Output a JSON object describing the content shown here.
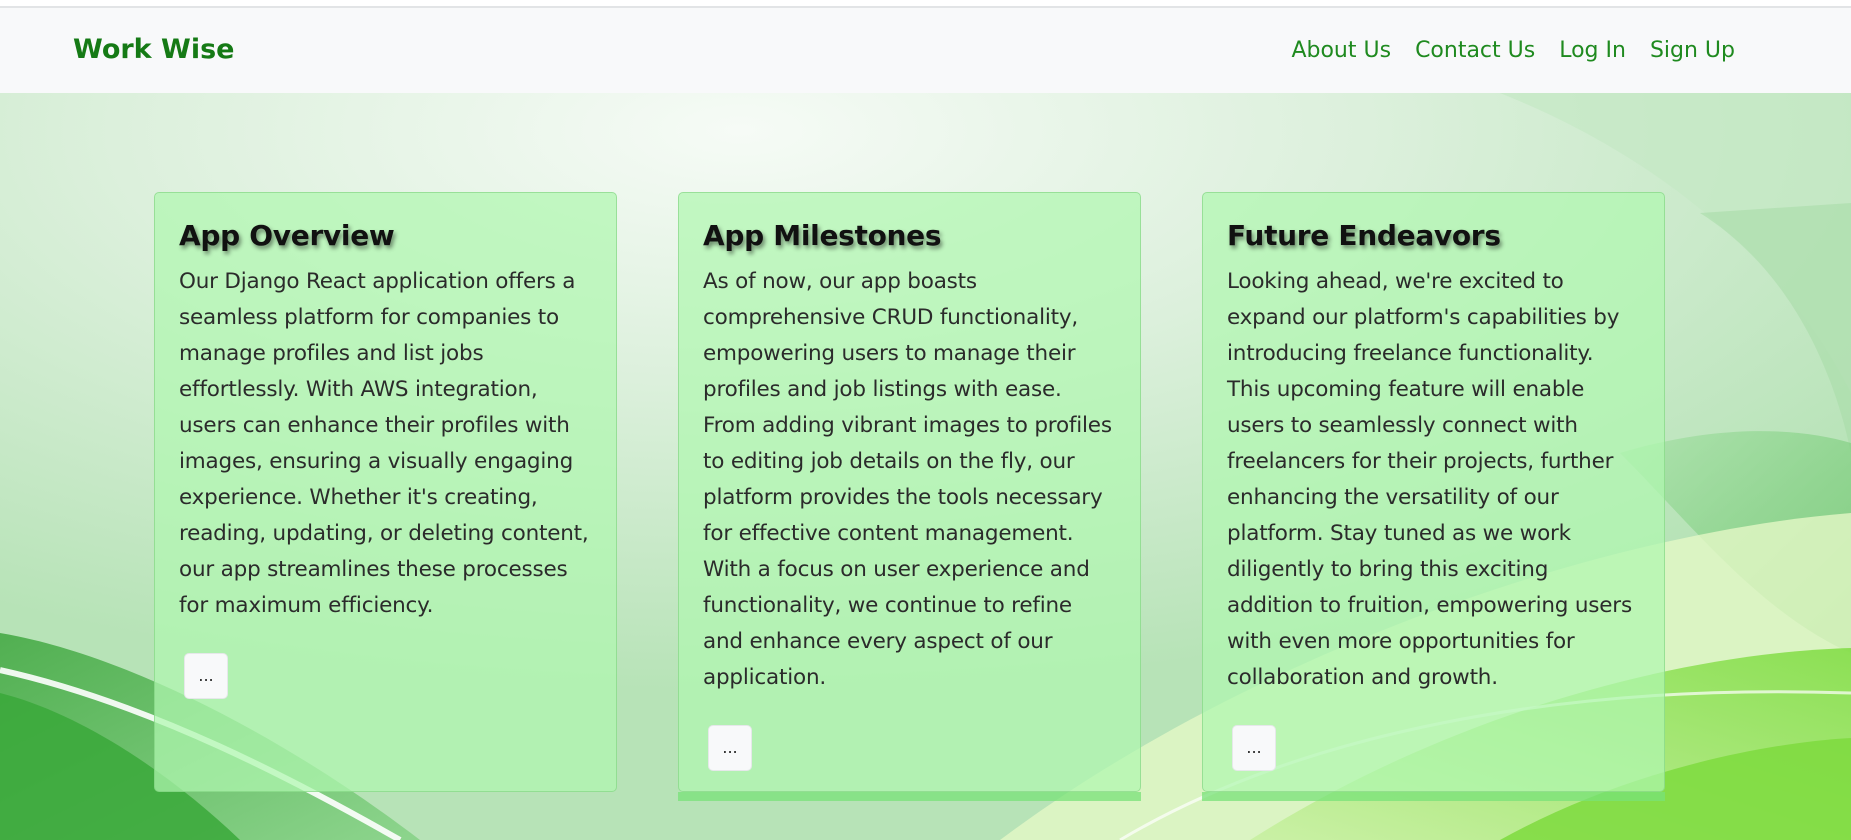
{
  "navbar": {
    "brand": "Work Wise",
    "links": [
      "About Us",
      "Contact Us",
      "Log In",
      "Sign Up"
    ]
  },
  "cards": [
    {
      "title": "App Overview",
      "text": "Our Django React application offers a seamless platform for companies to manage profiles and list jobs effortlessly. With AWS integration, users can enhance their profiles with images, ensuring a visually engaging experience. Whether it's creating, reading, updating, or deleting content, our app streamlines these processes for maximum efficiency.",
      "button_label": "..."
    },
    {
      "title": "App Milestones",
      "text": "As of now, our app boasts comprehensive CRUD functionality, empowering users to manage their profiles and job listings with ease. From adding vibrant images to profiles to editing job details on the fly, our platform provides the tools necessary for effective content management. With a focus on user experience and functionality, we continue to refine and enhance every aspect of our application.",
      "button_label": "..."
    },
    {
      "title": "Future Endeavors",
      "text": "Looking ahead, we're excited to expand our platform's capabilities by introducing freelance functionality. This upcoming feature will enable users to seamlessly connect with freelancers for their projects, further enhancing the versatility of our platform. Stay tuned as we work diligently to bring this exciting addition to fruition, empowering users with even more opportunities for collaboration and growth.",
      "button_label": "..."
    }
  ],
  "colors": {
    "brand": "#157a15",
    "nav_link": "#1f8a1f",
    "card_bg": "#b0f6b0",
    "navbar_bg": "#f8f9fa"
  }
}
